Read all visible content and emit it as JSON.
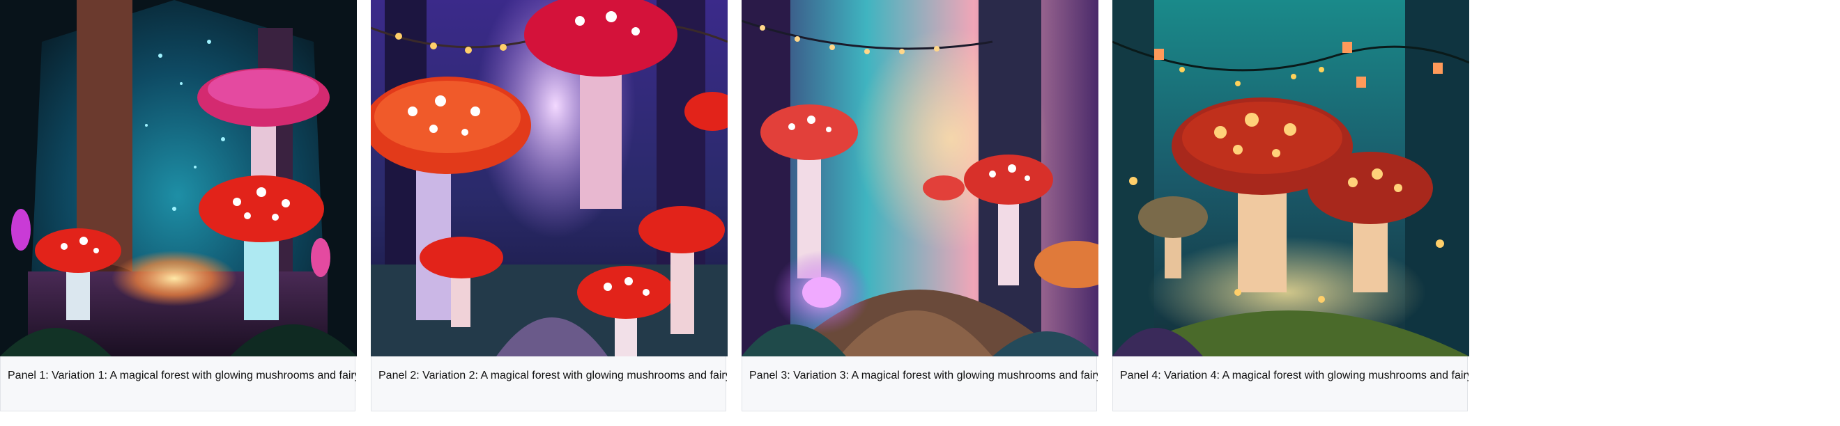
{
  "panels": [
    {
      "caption": "Panel 1: Variation 1: A magical forest with glowing mushrooms and fairy ...",
      "theme": {
        "sky": "#0b2a3a",
        "glow": "#29d3e6",
        "accent": "#c93bd6",
        "cap": "#e2231a"
      }
    },
    {
      "caption": "Panel 2: Variation 2: A magical forest with glowing mushrooms and fairy ...",
      "theme": {
        "sky": "#2a1a5e",
        "glow": "#b07be8",
        "accent": "#7d4bd1",
        "cap": "#e2231a"
      }
    },
    {
      "caption": "Panel 3: Variation 3: A magical forest with glowing mushrooms and fairy ...",
      "theme": {
        "sky": "#3a2a6a",
        "glow": "#f0b96a",
        "accent": "#5fd0c9",
        "cap": "#d8302a"
      }
    },
    {
      "caption": "Panel 4: Variation 4: A magical forest with glowing mushrooms and fairy ...",
      "theme": {
        "sky": "#0d4a4a",
        "glow": "#3ee6d6",
        "accent": "#ffd25a",
        "cap": "#a8281c"
      }
    }
  ]
}
